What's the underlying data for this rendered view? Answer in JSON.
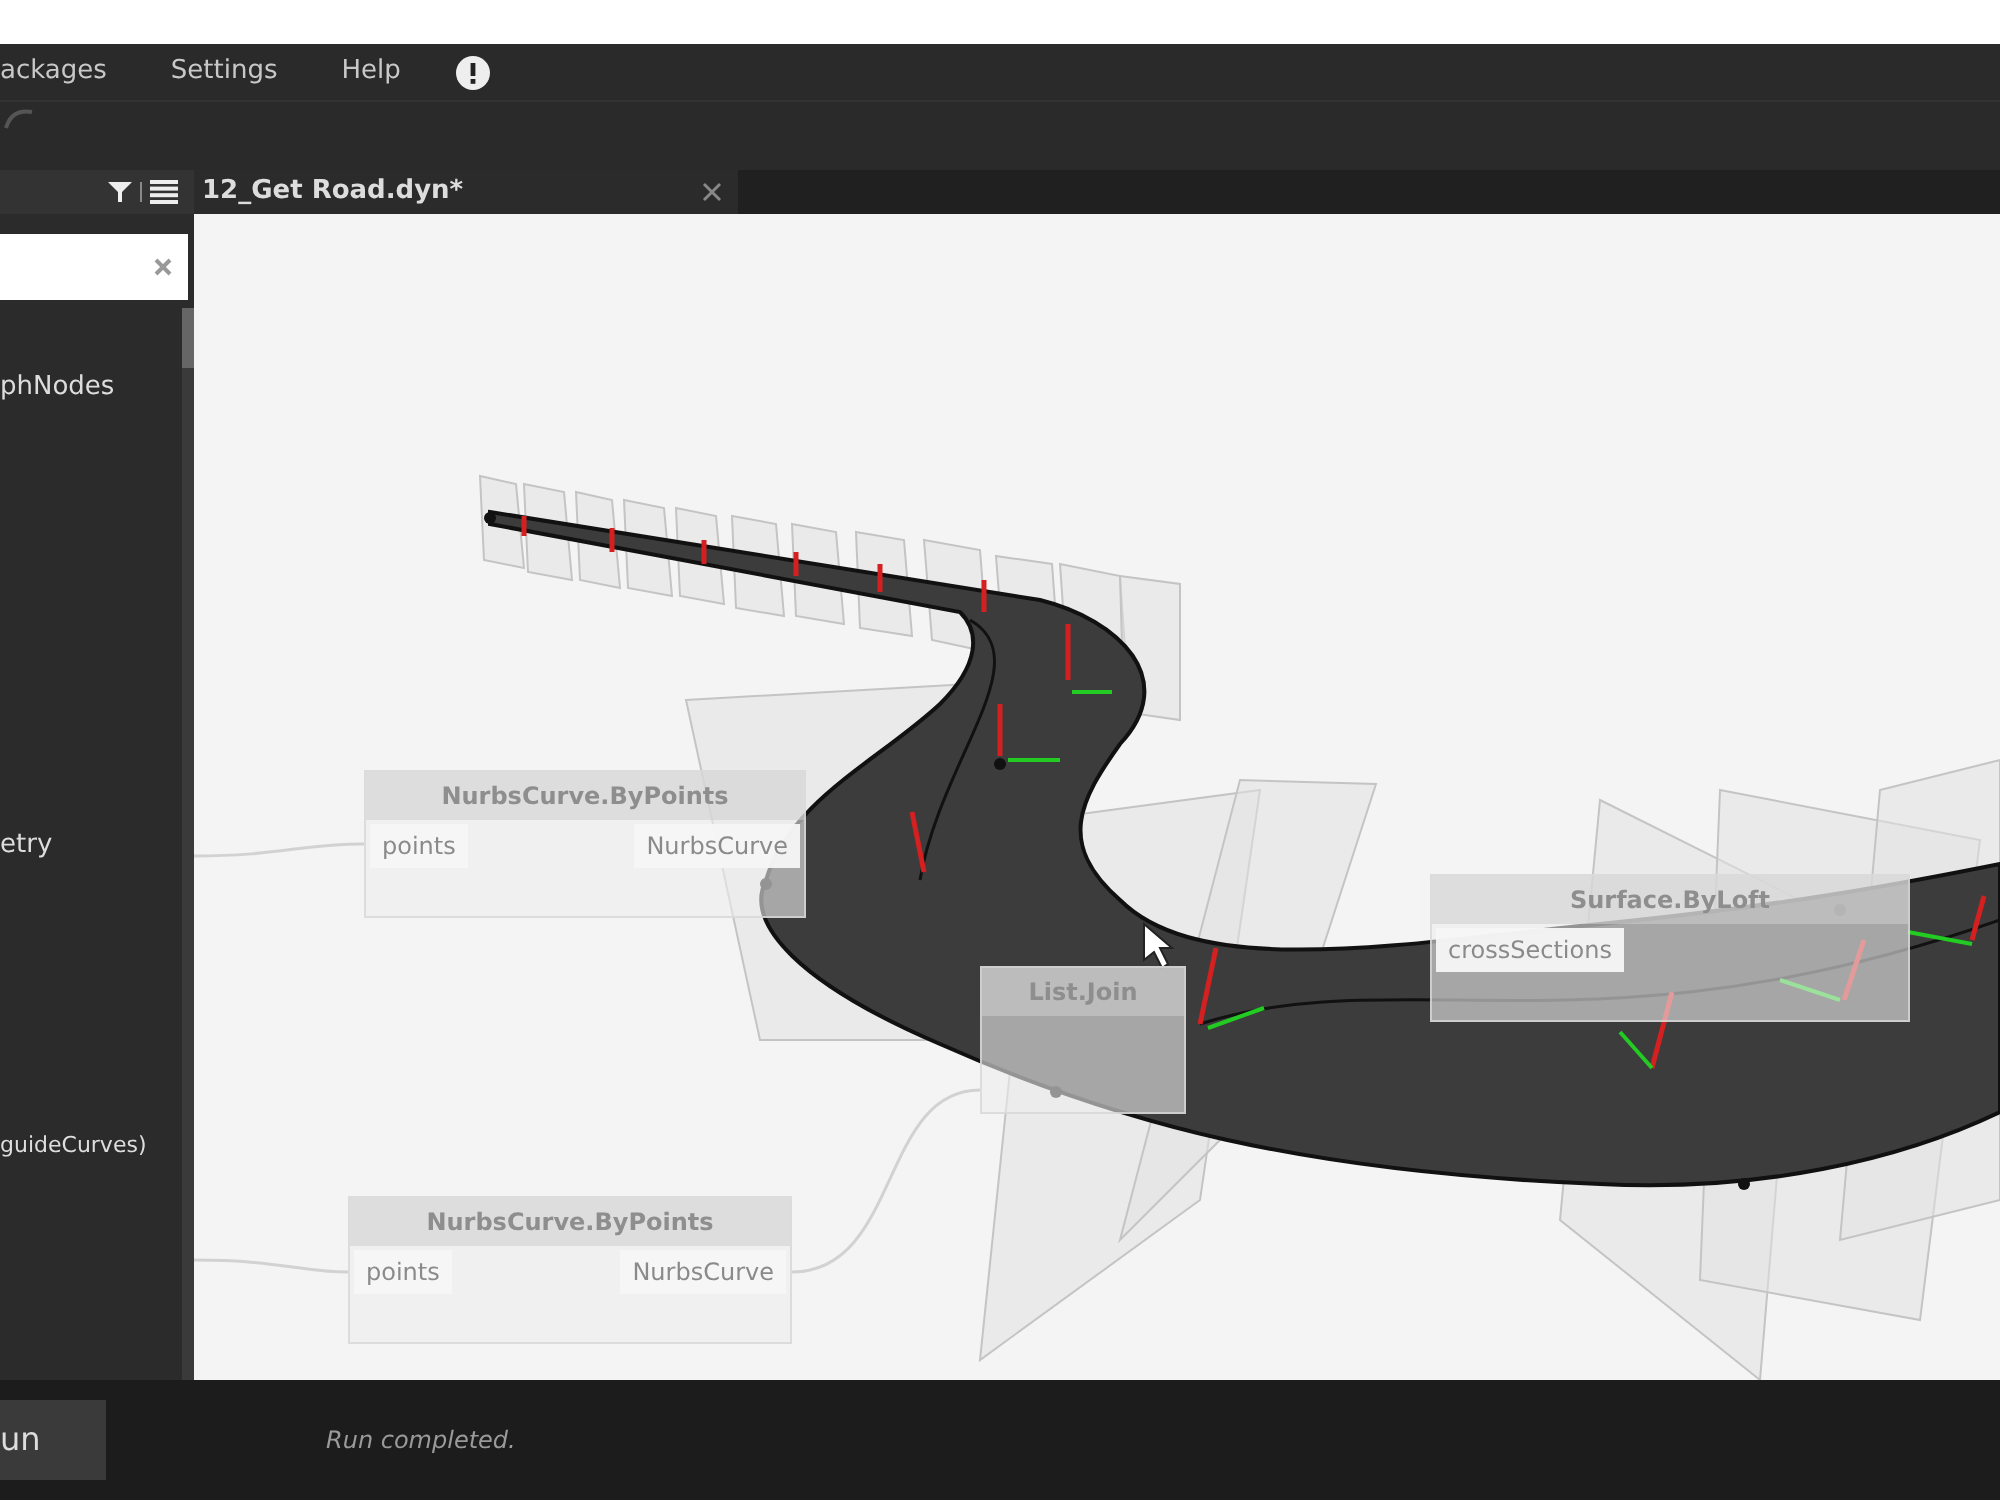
{
  "menu": [
    {
      "label": "ackages"
    },
    {
      "label": "Settings"
    },
    {
      "label": "Help"
    }
  ],
  "library": {
    "items": [
      {
        "label": "phNodes"
      },
      {
        "label": "etry"
      },
      {
        "label": "guideCurves)"
      }
    ]
  },
  "tabs": [
    {
      "label": "12_Get Road.dyn*",
      "selected": true
    }
  ],
  "nodes": [
    {
      "title": "NurbsCurve.ByPoints",
      "inputs": [
        "points"
      ],
      "outputs": [
        "NurbsCurve"
      ]
    },
    {
      "title": "List.Join"
    },
    {
      "title": "Surface.ByLoft",
      "inputs": [
        "crossSections"
      ]
    },
    {
      "title": "NurbsCurve.ByPoints",
      "inputs": [
        "points"
      ],
      "outputs": [
        "NurbsCurve"
      ]
    }
  ],
  "run_button": {
    "label": "un"
  },
  "status": "Run completed."
}
